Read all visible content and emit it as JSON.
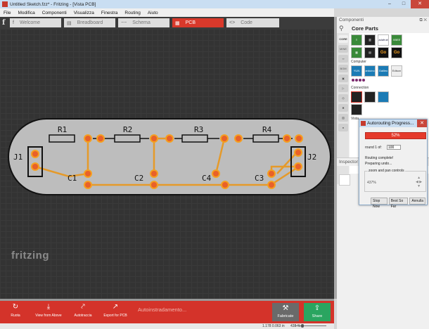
{
  "window": {
    "title": "Untitled Sketch.fzz* - Fritzing - [Vista PCB]",
    "minimize": "–",
    "maximize": "□",
    "close": "✕"
  },
  "menu": [
    "File",
    "Modifica",
    "Componenti",
    "Visualizza",
    "Finestra",
    "Routing",
    "Aiuto"
  ],
  "tabs": [
    {
      "label": "Welcome",
      "icon": "f"
    },
    {
      "label": "Breadboard",
      "icon": "▤"
    },
    {
      "label": "Schema",
      "icon": "−−"
    },
    {
      "label": "PCB",
      "icon": "▦"
    },
    {
      "label": "Code",
      "icon": "<>"
    }
  ],
  "logo_letter": "f",
  "pcb": {
    "resistors": [
      "R1",
      "R2",
      "R3",
      "R4"
    ],
    "capacitors": [
      "C1",
      "C2",
      "C4",
      "C3"
    ],
    "connectors": [
      "J1",
      "J2"
    ],
    "watermark": "fritzing"
  },
  "toolbar": {
    "buttons": [
      {
        "label": "Ruota",
        "icon": "↻"
      },
      {
        "label": "View from Above",
        "icon": "⤓"
      },
      {
        "label": "Autotraccia",
        "icon": "⤤"
      },
      {
        "label": "Export for PCB",
        "icon": "↗"
      }
    ],
    "status": "Autoinstradamento...",
    "fabricate": "Fabricate",
    "share": "Share"
  },
  "statusbar": {
    "coords": "1.178 0.063 in",
    "zoom": "438 %"
  },
  "right_panel": {
    "header": "Componenti",
    "title": "Core Parts",
    "bins": [
      "CORE",
      "MINE",
      "∞",
      "BOM",
      "▣",
      "▷",
      "◎",
      "✖",
      "▨",
      "●"
    ],
    "sections": [
      "Computer",
      "Connection"
    ],
    "parts_row1": [
      "≡",
      "▥",
      "adafruit",
      "XBEE"
    ],
    "parts_row2": [
      "▦",
      "▤",
      "Go",
      "Go"
    ],
    "parts_row3": [
      "YUN",
      "arduino",
      "Galileo",
      "Edison"
    ],
    "inspector": "Inspector",
    "vista": "Vista"
  },
  "dialog": {
    "title": "Autorouting Progress...",
    "progress": "52%",
    "round": "round 1 of:",
    "round_value": "100",
    "line1": "Routing complete!",
    "line2": "Preparing undo...",
    "zoom_label": "zoom and pan controls",
    "zoom_value": "437%",
    "buttons": [
      "Stop Now",
      "Best So Far",
      "Annulla"
    ]
  }
}
